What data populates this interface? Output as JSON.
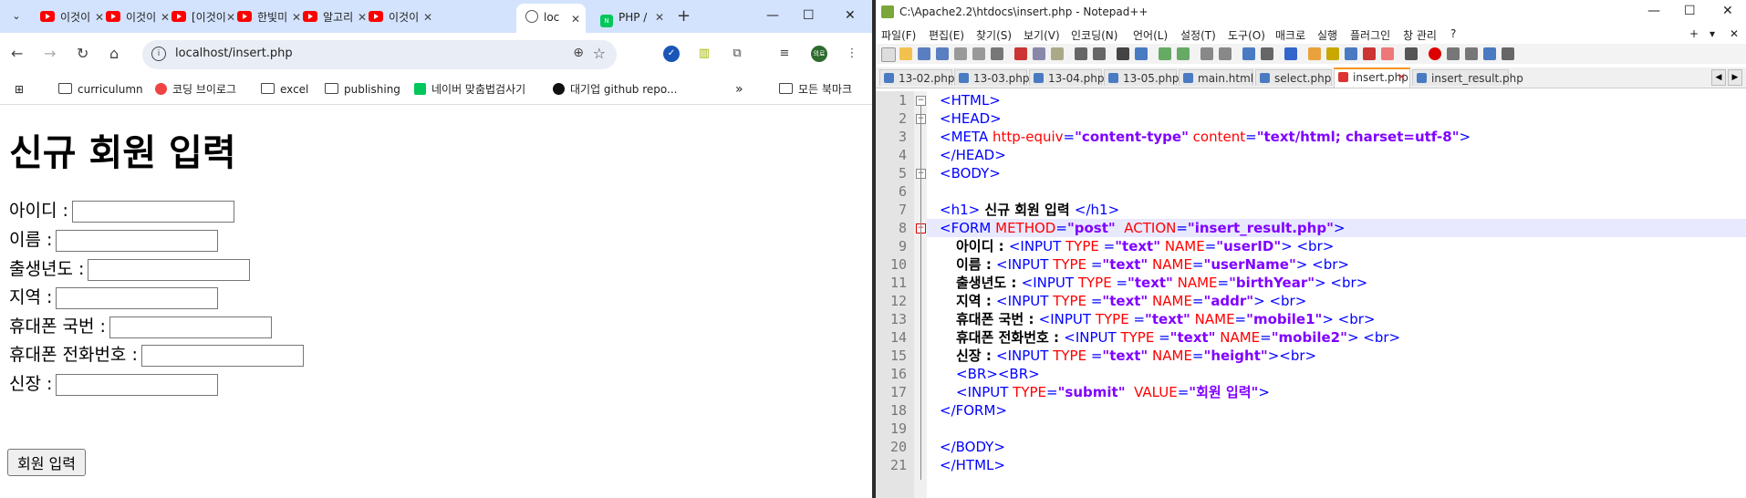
{
  "browser": {
    "tabs": [
      {
        "label": "이것이"
      },
      {
        "label": "이것이"
      },
      {
        "label": "[이것이"
      },
      {
        "label": "한빛미"
      },
      {
        "label": "알고리"
      },
      {
        "label": "이것이"
      },
      {
        "label": "loc"
      },
      {
        "label": "PHP / "
      }
    ],
    "window_controls": {
      "minimize": "—",
      "maximize": "☐",
      "close": "✕"
    },
    "url": "localhost/insert.php",
    "bookmarks": [
      {
        "label": "curriculumn"
      },
      {
        "label": "코딩 브이로그"
      },
      {
        "label": "excel"
      },
      {
        "label": "publishing"
      },
      {
        "label": "네이버 맞춤법검사기"
      },
      {
        "label": "대기업 github repo..."
      },
      {
        "label": "»"
      },
      {
        "label": "모든 북마크"
      }
    ],
    "avatar_text": "의료"
  },
  "page": {
    "title": "신규 회원 입력",
    "fields": [
      {
        "label": "아이디 :"
      },
      {
        "label": "이름 :"
      },
      {
        "label": "출생년도 :"
      },
      {
        "label": "지역 :"
      },
      {
        "label": "휴대폰 국번 :"
      },
      {
        "label": "휴대폰 전화번호 :"
      },
      {
        "label": "신장 :"
      }
    ],
    "submit_label": "회원 입력"
  },
  "notepad": {
    "title": "C:\\Apache2.2\\htdocs\\insert.php - Notepad++",
    "menu": [
      "파일(F)",
      "편집(E)",
      "찾기(S)",
      "보기(V)",
      "인코딩(N)",
      "언어(L)",
      "설정(T)",
      "도구(O)",
      "매크로",
      "실행",
      "플러그인",
      "창 관리",
      "?"
    ],
    "menu_right": [
      "+",
      "▾",
      "✕"
    ],
    "tabs": [
      {
        "label": "13-02.php"
      },
      {
        "label": "13-03.php"
      },
      {
        "label": "13-04.php"
      },
      {
        "label": "13-05.php"
      },
      {
        "label": "main.html"
      },
      {
        "label": "select.php"
      },
      {
        "label": "insert.php"
      },
      {
        "label": "insert_result.php"
      }
    ],
    "line_numbers": [
      "1",
      "2",
      "3",
      "4",
      "5",
      "6",
      "7",
      "8",
      "9",
      "10",
      "11",
      "12",
      "13",
      "14",
      "15",
      "16",
      "17",
      "18",
      "19",
      "20",
      "21"
    ],
    "code": {
      "l1": "<HTML>",
      "l2": "<HEAD>",
      "l3a": "<META ",
      "l3b": "http-equiv",
      "l3c": "=",
      "l3d": "\"content-type\"",
      "l3e": " content",
      "l3f": "=",
      "l3g": "\"text/html; charset=utf-8\"",
      "l3h": ">",
      "l4": "</HEAD>",
      "l5": "<BODY>",
      "l7a": "<h1>",
      "l7b": " 신규 회원 입력 ",
      "l7c": "</h1>",
      "l8a": "<FORM ",
      "l8b": "METHOD",
      "l8c": "=",
      "l8d": "\"post\"",
      "l8e": "  ACTION",
      "l8f": "=",
      "l8g": "\"insert_result.php\"",
      "l8h": ">",
      "rows": [
        {
          "label": "아이디 : ",
          "name": "\"userID\""
        },
        {
          "label": "이름 : ",
          "name": "\"userName\""
        },
        {
          "label": "출생년도 : ",
          "name": "\"birthYear\""
        },
        {
          "label": "지역 : ",
          "name": "\"addr\""
        },
        {
          "label": "휴대폰 국번 : ",
          "name": "\"mobile1\""
        },
        {
          "label": "휴대폰 전화번호 : ",
          "name": "\"mobile2\""
        },
        {
          "label": "신장 : ",
          "name": "\"height\""
        }
      ],
      "input_open": "<INPUT ",
      "type_attr": "TYPE",
      "eq_sp": " =",
      "text_val": "\"text\"",
      "name_attr": " NAME",
      "eq": "=",
      "close_br": "> <br>",
      "close_br_tight": "><br>",
      "l16": "<BR><BR>",
      "l17a": "<INPUT ",
      "l17b": "TYPE",
      "l17c": "=",
      "l17d": "\"submit\"",
      "l17e": "  VALUE",
      "l17f": "=",
      "l17g": "\"회원 입력\"",
      "l17h": ">",
      "l18": "</FORM>",
      "l20": "</BODY>",
      "l21": "</HTML>"
    }
  }
}
